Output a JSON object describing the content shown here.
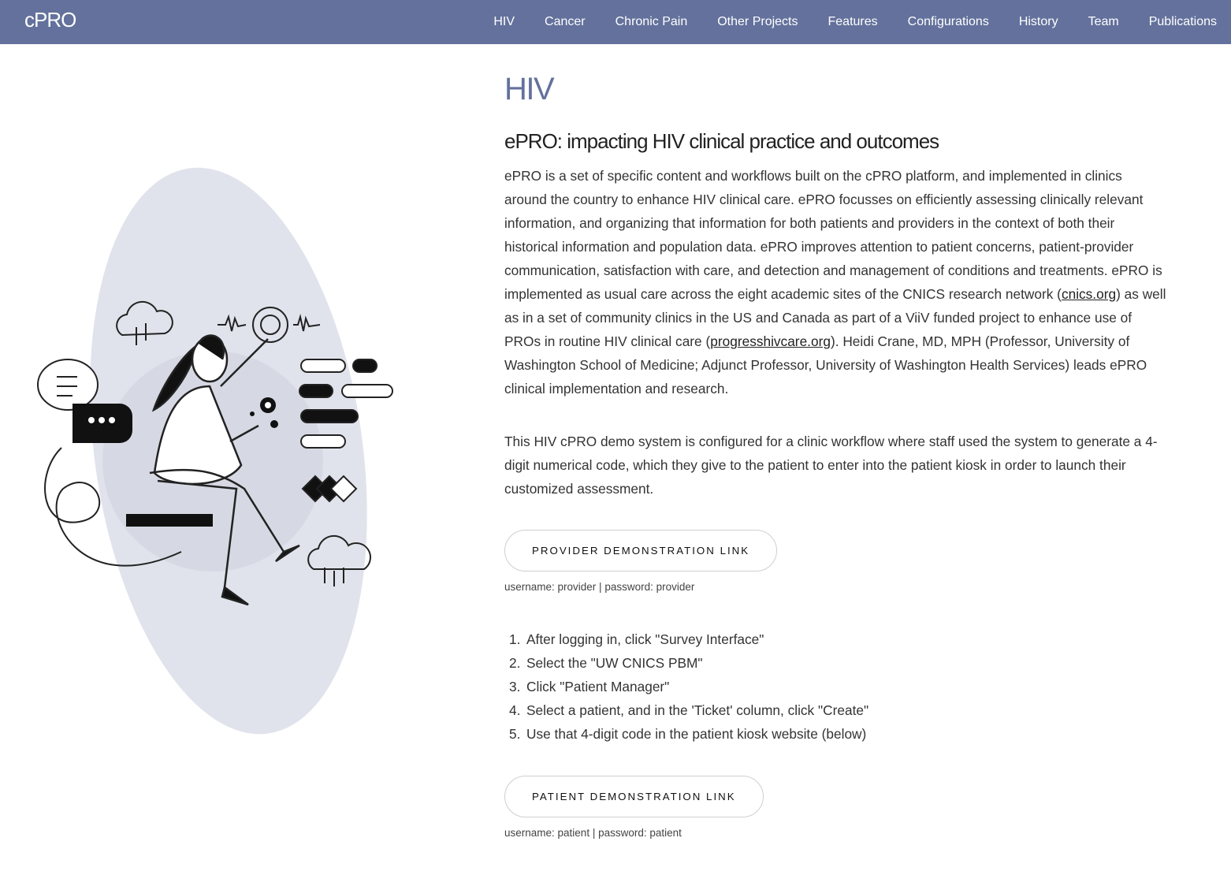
{
  "nav": {
    "brand": "cPRO",
    "links": [
      "HIV",
      "Cancer",
      "Chronic Pain",
      "Other Projects",
      "Features",
      "Configurations",
      "History",
      "Team",
      "Publications"
    ]
  },
  "page": {
    "title": "HIV",
    "subtitle": "ePRO: impacting HIV clinical practice and outcomes",
    "intro": {
      "part1": "ePRO is a set of specific content and workflows built on the cPRO platform, and implemented in clinics around the country to enhance HIV clinical care. ePRO focusses on efficiently assessing clinically relevant information, and organizing that information for both patients and providers in the context of both their historical information and population data. ePRO improves attention to patient concerns, patient-provider communication, satisfaction with care, and detection and management of conditions and treatments. ePRO is implemented as usual care across the eight academic sites of the CNICS research network (",
      "link1": "cnics.org",
      "part2": ") as well as in a set of community clinics in the US and Canada as part of a ViiV funded project to enhance use of PROs in routine HIV clinical care (",
      "link2": "progresshivcare.org",
      "part3": "). Heidi Crane, MD, MPH (Professor, University of Washington School of Medicine; Adjunct Professor, University of Washington Health Services) leads ePRO clinical implementation and research."
    },
    "demo_paragraph": "This HIV cPRO demo system is configured for a clinic workflow where staff used the system to generate a 4-digit numerical code, which they give to the patient to enter into the patient kiosk in order to launch their customized assessment.",
    "provider_button": "PROVIDER DEMONSTRATION LINK",
    "provider_creds": "username: provider | password: provider",
    "steps": [
      "After logging in, click \"Survey Interface\"",
      "Select the \"UW CNICS PBM\"",
      "Click \"Patient Manager\"",
      "Select a patient, and in the 'Ticket' column, click \"Create\"",
      "Use that 4-digit code in the patient kiosk website (below)"
    ],
    "step_numbers": [
      "1.",
      "2.",
      "3.",
      "4.",
      "5."
    ],
    "patient_button": "PATIENT DEMONSTRATION LINK",
    "patient_creds": "username: patient | password: patient"
  },
  "colors": {
    "navbar": "#63719c",
    "title": "#63719c",
    "blob": "#e1e3ec"
  },
  "icons": [
    "cloud-icon",
    "pulse-icon",
    "chat-bubble-icon",
    "ellipsis-icon",
    "diamonds-icon",
    "toggle-pills-icon"
  ]
}
